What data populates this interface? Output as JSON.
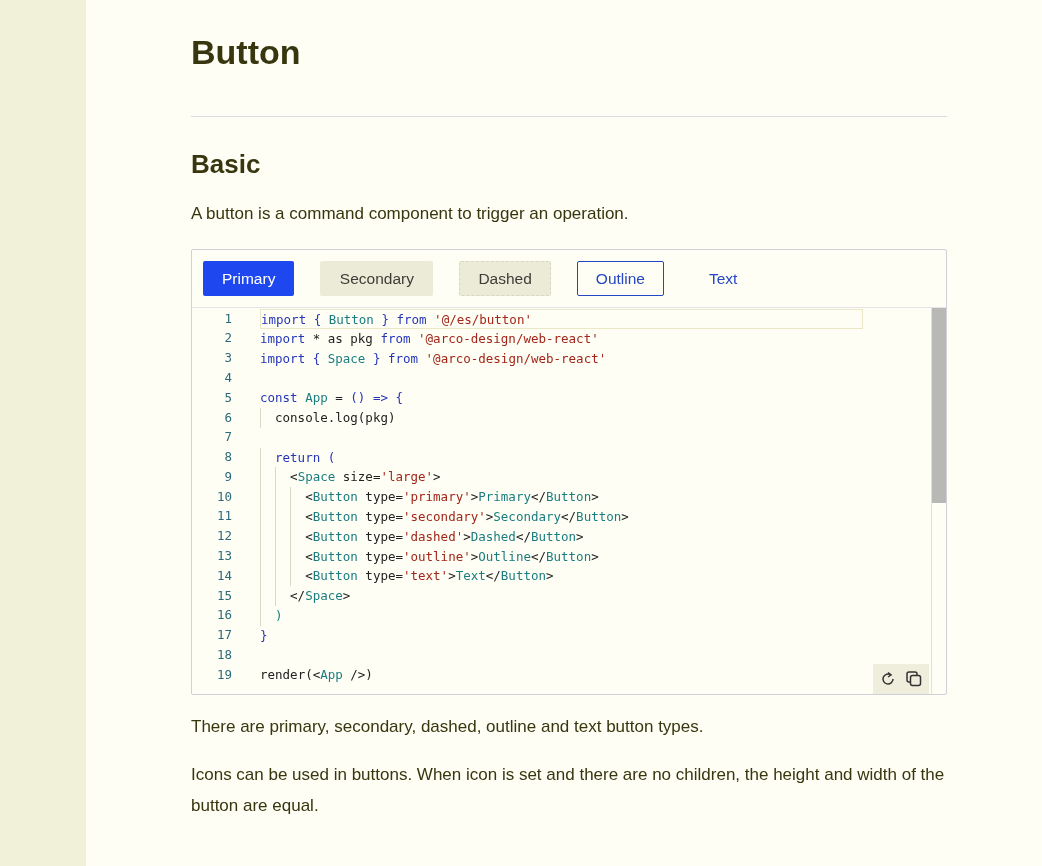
{
  "title": "Button",
  "section": {
    "heading": "Basic",
    "description": "A button is a command component to trigger an operation."
  },
  "demo": {
    "buttons": [
      {
        "label": "Primary",
        "kind": "primary"
      },
      {
        "label": "Secondary",
        "kind": "secondary"
      },
      {
        "label": "Dashed",
        "kind": "dashed"
      },
      {
        "label": "Outline",
        "kind": "outline"
      },
      {
        "label": "Text",
        "kind": "text"
      }
    ],
    "code": {
      "lines": [
        {
          "number": "1",
          "active": true,
          "tokens": [
            {
              "kind": "kw",
              "text": "import { "
            },
            {
              "kind": "tag",
              "text": "Button"
            },
            {
              "kind": "kw",
              "text": " } from "
            },
            {
              "kind": "str",
              "text": "'@/es/button'"
            }
          ]
        },
        {
          "number": "2",
          "active": false,
          "tokens": [
            {
              "kind": "kw",
              "text": "import"
            },
            {
              "kind": "plain",
              "text": " * as pkg "
            },
            {
              "kind": "kw",
              "text": "from "
            },
            {
              "kind": "str",
              "text": "'@arco-design/web-react'"
            }
          ]
        },
        {
          "number": "3",
          "active": false,
          "tokens": [
            {
              "kind": "kw",
              "text": "import { "
            },
            {
              "kind": "tag",
              "text": "Space"
            },
            {
              "kind": "kw",
              "text": " } from "
            },
            {
              "kind": "str",
              "text": "'@arco-design/web-react'"
            }
          ]
        },
        {
          "number": "4",
          "active": false
        },
        {
          "number": "5",
          "active": false,
          "tokens": [
            {
              "kind": "kw",
              "text": "const "
            },
            {
              "kind": "tag",
              "text": "App"
            },
            {
              "kind": "plain",
              "text": " = "
            },
            {
              "kind": "kw",
              "text": "() => {"
            }
          ]
        },
        {
          "number": "6",
          "active": false,
          "tokens": [
            {
              "kind": "plain",
              "text": "  console.log(pkg)"
            }
          ]
        },
        {
          "number": "7",
          "active": false
        },
        {
          "number": "8",
          "active": false,
          "tokens": [
            {
              "kind": "kw",
              "text": "  return ("
            }
          ]
        },
        {
          "number": "9",
          "active": false,
          "tokens": [
            {
              "kind": "plain",
              "text": "    <"
            },
            {
              "kind": "tag",
              "text": "Space"
            },
            {
              "kind": "plain",
              "text": " size="
            },
            {
              "kind": "str",
              "text": "'large'"
            },
            {
              "kind": "plain",
              "text": ">"
            }
          ]
        },
        {
          "number": "10",
          "active": false,
          "tokens": [
            {
              "kind": "plain",
              "text": "      <"
            },
            {
              "kind": "tag",
              "text": "Button"
            },
            {
              "kind": "plain",
              "text": " type="
            },
            {
              "kind": "str",
              "text": "'primary'"
            },
            {
              "kind": "plain",
              "text": ">"
            },
            {
              "kind": "tag",
              "text": "Primary"
            },
            {
              "kind": "plain",
              "text": "</"
            },
            {
              "kind": "tag",
              "text": "Button"
            },
            {
              "kind": "plain",
              "text": ">"
            }
          ]
        },
        {
          "number": "11",
          "active": false,
          "tokens": [
            {
              "kind": "plain",
              "text": "      <"
            },
            {
              "kind": "tag",
              "text": "Button"
            },
            {
              "kind": "plain",
              "text": " type="
            },
            {
              "kind": "str",
              "text": "'secondary'"
            },
            {
              "kind": "plain",
              "text": ">"
            },
            {
              "kind": "tag",
              "text": "Secondary"
            },
            {
              "kind": "plain",
              "text": "</"
            },
            {
              "kind": "tag",
              "text": "Button"
            },
            {
              "kind": "plain",
              "text": ">"
            }
          ]
        },
        {
          "number": "12",
          "active": false,
          "tokens": [
            {
              "kind": "plain",
              "text": "      <"
            },
            {
              "kind": "tag",
              "text": "Button"
            },
            {
              "kind": "plain",
              "text": " type="
            },
            {
              "kind": "str",
              "text": "'dashed'"
            },
            {
              "kind": "plain",
              "text": ">"
            },
            {
              "kind": "tag",
              "text": "Dashed"
            },
            {
              "kind": "plain",
              "text": "</"
            },
            {
              "kind": "tag",
              "text": "Button"
            },
            {
              "kind": "plain",
              "text": ">"
            }
          ]
        },
        {
          "number": "13",
          "active": false,
          "tokens": [
            {
              "kind": "plain",
              "text": "      <"
            },
            {
              "kind": "tag",
              "text": "Button"
            },
            {
              "kind": "plain",
              "text": " type="
            },
            {
              "kind": "str",
              "text": "'outline'"
            },
            {
              "kind": "plain",
              "text": ">"
            },
            {
              "kind": "tag",
              "text": "Outline"
            },
            {
              "kind": "plain",
              "text": "</"
            },
            {
              "kind": "tag",
              "text": "Button"
            },
            {
              "kind": "plain",
              "text": ">"
            }
          ]
        },
        {
          "number": "14",
          "active": false,
          "tokens": [
            {
              "kind": "plain",
              "text": "      <"
            },
            {
              "kind": "tag",
              "text": "Button"
            },
            {
              "kind": "plain",
              "text": " type="
            },
            {
              "kind": "str",
              "text": "'text'"
            },
            {
              "kind": "plain",
              "text": ">"
            },
            {
              "kind": "tag",
              "text": "Text"
            },
            {
              "kind": "plain",
              "text": "</"
            },
            {
              "kind": "tag",
              "text": "Button"
            },
            {
              "kind": "plain",
              "text": ">"
            }
          ]
        },
        {
          "number": "15",
          "active": false,
          "tokens": [
            {
              "kind": "plain",
              "text": "    </"
            },
            {
              "kind": "tag",
              "text": "Space"
            },
            {
              "kind": "plain",
              "text": ">"
            }
          ]
        },
        {
          "number": "16",
          "active": false,
          "tokens": [
            {
              "kind": "tag",
              "text": "  )"
            }
          ]
        },
        {
          "number": "17",
          "active": false,
          "tokens": [
            {
              "kind": "kw",
              "text": "}"
            }
          ]
        },
        {
          "number": "18",
          "active": false
        },
        {
          "number": "19",
          "active": false,
          "tokens": [
            {
              "kind": "plain",
              "text": "render("
            },
            {
              "kind": "plain",
              "text": "<"
            },
            {
              "kind": "tag",
              "text": "App"
            },
            {
              "kind": "plain",
              "text": " />)"
            }
          ]
        }
      ]
    }
  },
  "paragraphs": [
    "There are primary, secondary, dashed, outline and text button types.",
    "Icons can be used in buttons. When icon is set and there are no children, the height and width of the button are equal."
  ]
}
